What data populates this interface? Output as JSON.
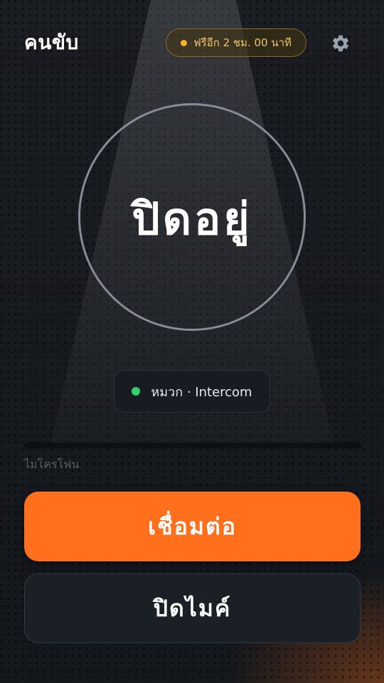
{
  "header": {
    "title": "คนขับ",
    "free_badge": "ฟรีอีก 2 ชม. 00 นาที",
    "settings_icon": "gear-icon"
  },
  "status": {
    "label": "ปิดอยู่"
  },
  "channel": {
    "label": "หมวก · Intercom",
    "indicator_color": "#32d06a"
  },
  "microphone": {
    "label": "ไมโครโฟน"
  },
  "actions": {
    "connect_label": "เชื่อมต่อ",
    "mute_label": "ปิดไมค์"
  },
  "colors": {
    "accent": "#ff6f1c",
    "badge_dot": "#f5b324",
    "background": "#15181d"
  }
}
